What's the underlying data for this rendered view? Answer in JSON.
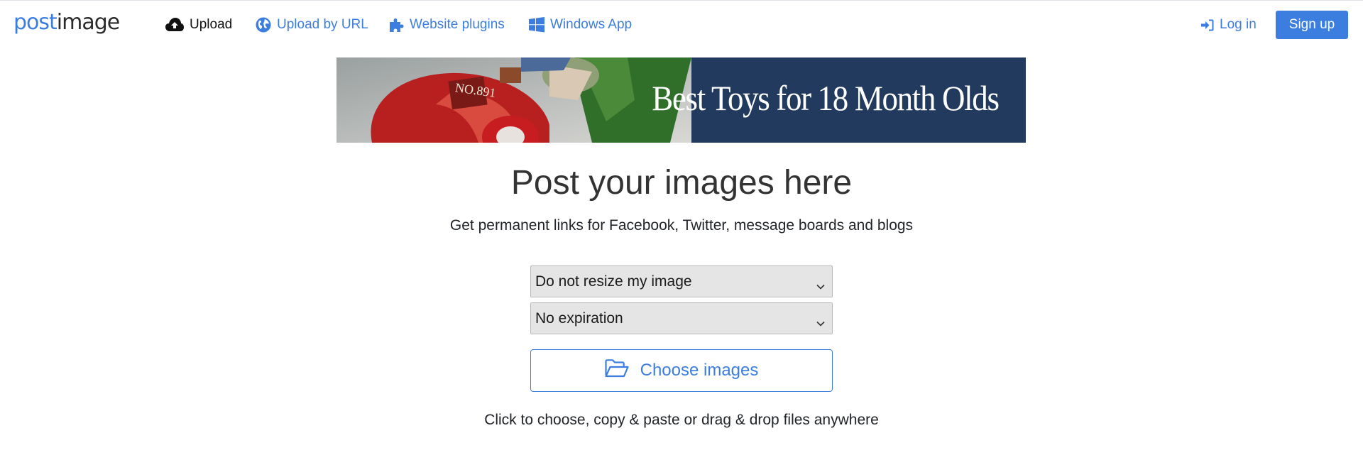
{
  "brand": {
    "part1": "post",
    "part2": "image"
  },
  "nav": {
    "upload": "Upload",
    "upload_by_url": "Upload by URL",
    "website_plugins": "Website plugins",
    "windows_app": "Windows App",
    "login": "Log in",
    "signup": "Sign up"
  },
  "banner": {
    "text": "Best Toys for 18 Month Olds",
    "tag": "NO.891"
  },
  "main": {
    "title": "Post your images here",
    "subtitle": "Get permanent links for Facebook, Twitter, message boards and blogs",
    "resize_select": "Do not resize my image",
    "expiration_select": "No expiration",
    "choose_button": "Choose images",
    "hint": "Click to choose, copy & paste or drag & drop files anywhere"
  },
  "colors": {
    "accent": "#3c7ee0",
    "banner_bg": "#223a5e"
  }
}
